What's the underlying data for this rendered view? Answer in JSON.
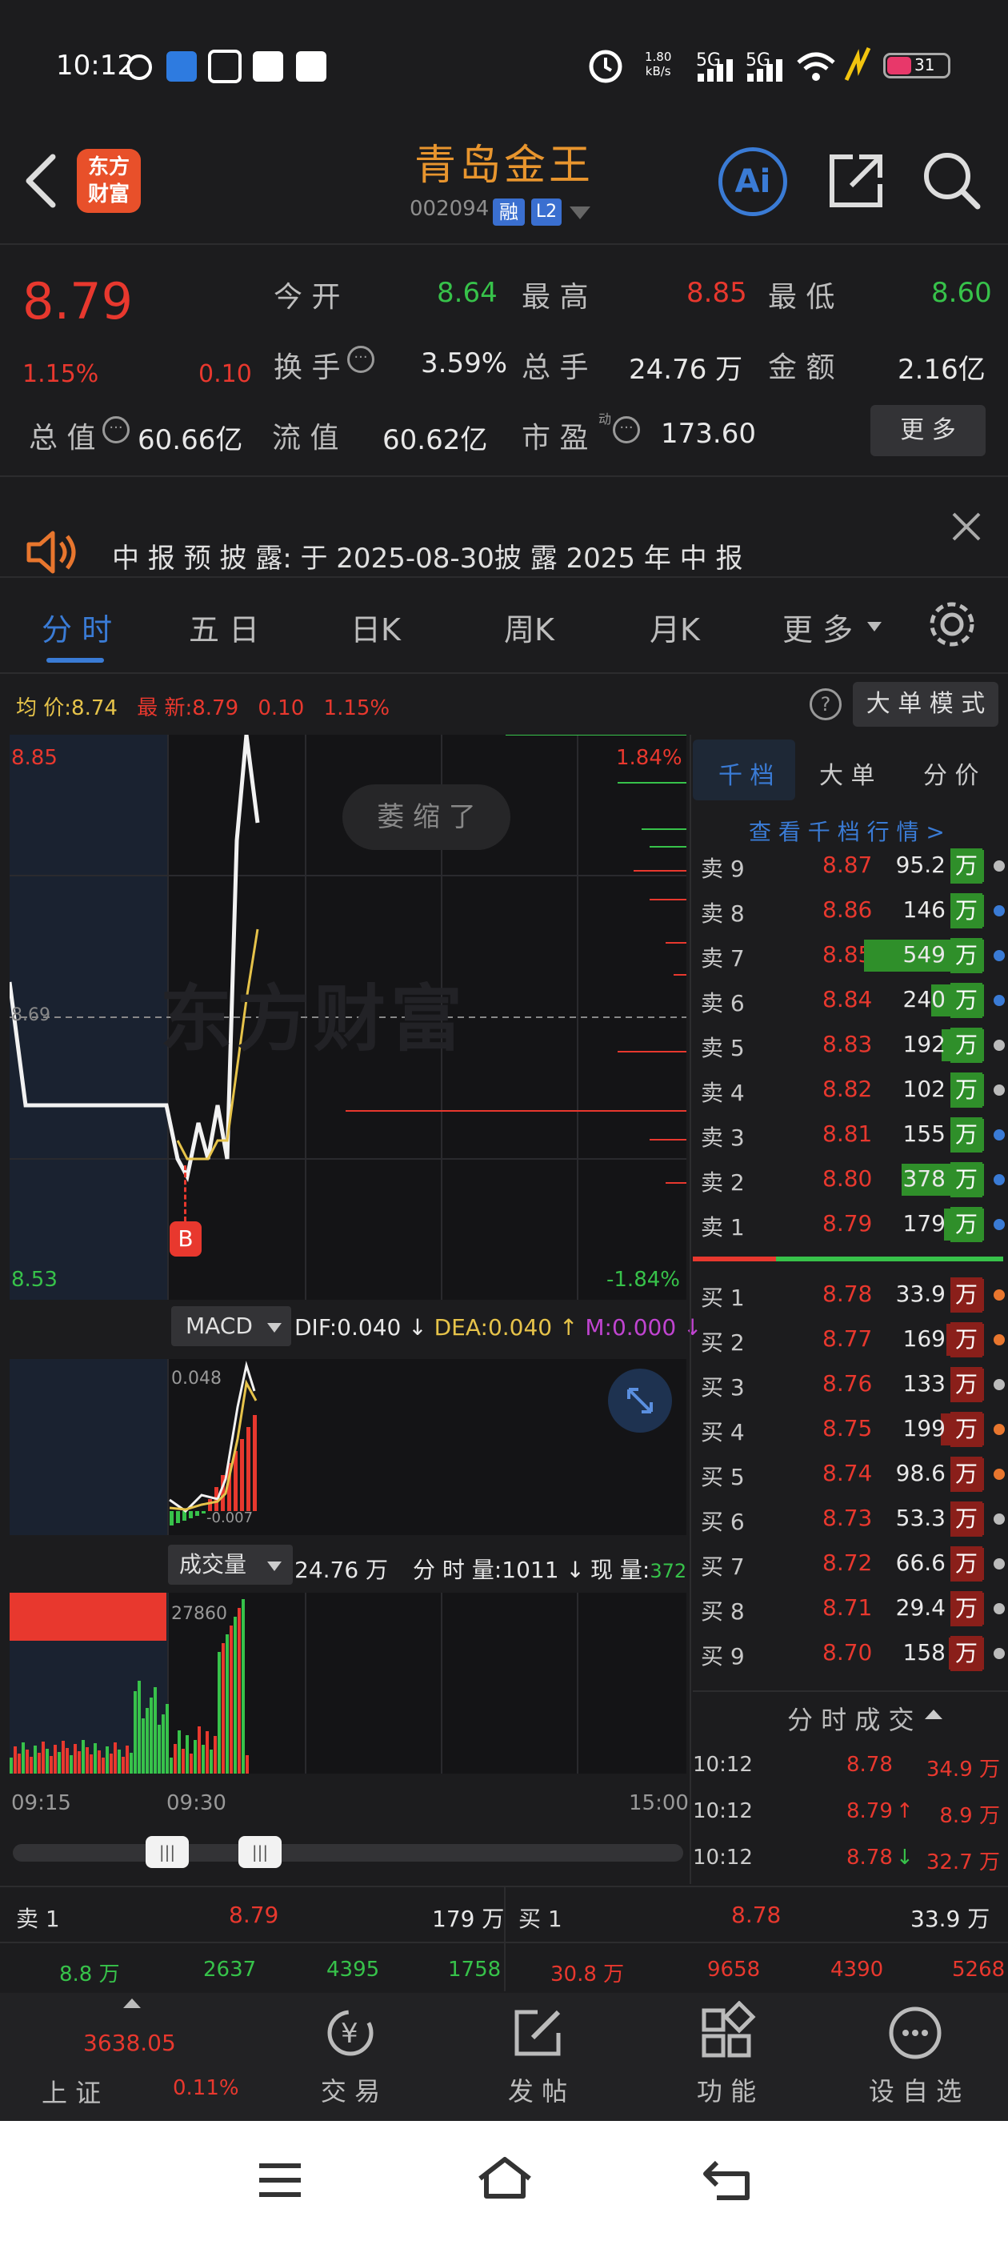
{
  "status_bar": {
    "time": "10:12",
    "net_speed_top": "1.80",
    "net_speed_unit": "kB/s",
    "signal1": "5G",
    "signal2": "5G",
    "battery": "31"
  },
  "header": {
    "title": "青岛金王",
    "code": "002094",
    "tag_rong": "融",
    "tag_l2": "L2",
    "brand_line1": "东方",
    "brand_line2": "财富",
    "ai_label": "Ai"
  },
  "quote": {
    "price": "8.79",
    "change_pct": "1.15%",
    "change": "0.10",
    "open_label": "今 开",
    "open": "8.64",
    "high_label": "最 高",
    "high": "8.85",
    "low_label": "最 低",
    "low": "8.60",
    "turnover_label": "换 手",
    "turnover": "3.59%",
    "volume_label": "总 手",
    "volume": "24.76 万",
    "amount_label": "金 额",
    "amount": "2.16亿",
    "mcap_label": "总 值",
    "mcap": "60.66亿",
    "float_label": "流 值",
    "float_cap": "60.62亿",
    "pe_label": "市 盈",
    "pe_sup": "动",
    "pe": "173.60",
    "more_button": "更 多"
  },
  "notice": {
    "text": "中 报 预 披 露: 于 2025-08-30披 露 2025 年 中 报"
  },
  "tabs": [
    "分 时",
    "五 日",
    "日K",
    "周K",
    "月K",
    "更 多"
  ],
  "info_line": {
    "avg_label": "均 价:",
    "avg": "8.74",
    "latest_label": "最 新:",
    "latest": "8.79",
    "change": "0.10",
    "pct": "1.15%",
    "mode_button": "大 单 模 式"
  },
  "chart": {
    "y_top": "8.85",
    "y_bottom": "8.53",
    "y_mid": "8.69",
    "pct_top": "1.84%",
    "pct_bottom": "-1.84%",
    "watermark": "东方财富",
    "collapse_label": "萎 缩 了",
    "buy_marker": "B",
    "macd_button": "MACD",
    "dif": "DIF:0.040",
    "dea": "DEA:0.040",
    "m": "M:0.000",
    "macd_top": "0.048",
    "macd_bottom": "-0.007",
    "vol_button": "成交量",
    "vol_total": "24.76 万",
    "vol_min_label": "分 时 量:",
    "vol_min": "1011",
    "vol_now_label": "现 量:",
    "vol_now": "372",
    "vol_top": "27860",
    "t_start": "09:15",
    "t_open": "09:30",
    "t_end": "15:00"
  },
  "chart_data": {
    "type": "line",
    "x": [
      "09:15",
      "09:16",
      "09:17",
      "09:18",
      "09:19",
      "09:20",
      "09:21",
      "09:22",
      "09:23",
      "09:24",
      "09:25",
      "09:30",
      "09:31",
      "09:32",
      "09:33",
      "09:34",
      "09:35",
      "09:36",
      "09:37",
      "09:38"
    ],
    "series": [
      {
        "values": [
          8.71,
          8.64,
          8.64,
          8.64,
          8.64,
          8.64,
          8.64,
          8.64,
          8.64,
          8.64,
          8.64,
          8.61,
          8.6,
          8.63,
          8.61,
          8.64,
          8.61,
          8.79,
          8.85,
          8.8
        ]
      },
      {
        "values": [
          null,
          null,
          null,
          null,
          null,
          null,
          null,
          null,
          null,
          null,
          null,
          8.62,
          8.61,
          8.61,
          8.61,
          8.62,
          8.62,
          8.66,
          8.7,
          8.74
        ]
      }
    ],
    "ylim": [
      8.53,
      8.85
    ]
  },
  "orderbook": {
    "tabs": [
      "千 档",
      "大 单",
      "分 价"
    ],
    "link": "查 看 千 档 行 情 >",
    "asks": [
      {
        "name": "卖 9",
        "price": "8.87",
        "vol": "95.2",
        "unit": "万",
        "pct": 0.17,
        "dot": "#bbbbbb"
      },
      {
        "name": "卖 8",
        "price": "8.86",
        "vol": "146",
        "unit": "万",
        "pct": 0.27,
        "dot": "#3a7bd5"
      },
      {
        "name": "卖 7",
        "price": "8.85",
        "vol": "549",
        "unit": "万",
        "pct": 1.0,
        "dot": "#3a7bd5"
      },
      {
        "name": "卖 6",
        "price": "8.84",
        "vol": "240",
        "unit": "万",
        "pct": 0.44,
        "dot": "#3a7bd5"
      },
      {
        "name": "卖 5",
        "price": "8.83",
        "vol": "192",
        "unit": "万",
        "pct": 0.35,
        "dot": "#bbbbbb"
      },
      {
        "name": "卖 4",
        "price": "8.82",
        "vol": "102",
        "unit": "万",
        "pct": 0.19,
        "dot": "#bbbbbb"
      },
      {
        "name": "卖 3",
        "price": "8.81",
        "vol": "155",
        "unit": "万",
        "pct": 0.28,
        "dot": "#3a7bd5"
      },
      {
        "name": "卖 2",
        "price": "8.80",
        "vol": "378",
        "unit": "万",
        "pct": 0.69,
        "dot": "#3a7bd5"
      },
      {
        "name": "卖 1",
        "price": "8.79",
        "vol": "179",
        "unit": "万",
        "pct": 0.33,
        "dot": "#3a7bd5"
      }
    ],
    "bids": [
      {
        "name": "买 1",
        "price": "8.78",
        "vol": "33.9",
        "unit": "万",
        "pct": 0.06,
        "dot": "#e8762e"
      },
      {
        "name": "买 2",
        "price": "8.77",
        "vol": "169",
        "unit": "万",
        "pct": 0.31,
        "dot": "#e8762e"
      },
      {
        "name": "买 3",
        "price": "8.76",
        "vol": "133",
        "unit": "万",
        "pct": 0.24,
        "dot": "#bbbbbb"
      },
      {
        "name": "买 4",
        "price": "8.75",
        "vol": "199",
        "unit": "万",
        "pct": 0.36,
        "dot": "#e8762e"
      },
      {
        "name": "买 5",
        "price": "8.74",
        "vol": "98.6",
        "unit": "万",
        "pct": 0.18,
        "dot": "#e8762e"
      },
      {
        "name": "买 6",
        "price": "8.73",
        "vol": "53.3",
        "unit": "万",
        "pct": 0.1,
        "dot": "#bbbbbb"
      },
      {
        "name": "买 7",
        "price": "8.72",
        "vol": "66.6",
        "unit": "万",
        "pct": 0.12,
        "dot": "#bbbbbb"
      },
      {
        "name": "买 8",
        "price": "8.71",
        "vol": "29.4",
        "unit": "万",
        "pct": 0.05,
        "dot": "#bbbbbb"
      },
      {
        "name": "买 9",
        "price": "8.70",
        "vol": "158",
        "unit": "万",
        "pct": 0.29,
        "dot": "#bbbbbb"
      }
    ],
    "ticks_title": "分 时 成 交",
    "ticks": [
      {
        "time": "10:12",
        "price": "8.78",
        "vol": "34.9 万",
        "arrow": ""
      },
      {
        "time": "10:12",
        "price": "8.79",
        "vol": "8.9 万",
        "arrow": "↑"
      },
      {
        "time": "10:12",
        "price": "8.78",
        "vol": "32.7 万",
        "arrow": "↓"
      }
    ]
  },
  "summary": {
    "sell_label": "卖 1",
    "sell_price": "8.79",
    "sell_vol": "179 万",
    "buy_label": "买 1",
    "buy_price": "8.78",
    "buy_vol": "33.9 万",
    "row2": [
      "8.8 万",
      "2637",
      "4395",
      "1758",
      "30.8 万",
      "9658",
      "4390",
      "5268"
    ]
  },
  "bottom_nav": {
    "index_value": "3638.05",
    "index_name": "上 证",
    "index_pct": "0.11%",
    "items": [
      "交 易",
      "发 帖",
      "功 能",
      "设 自 选"
    ]
  }
}
